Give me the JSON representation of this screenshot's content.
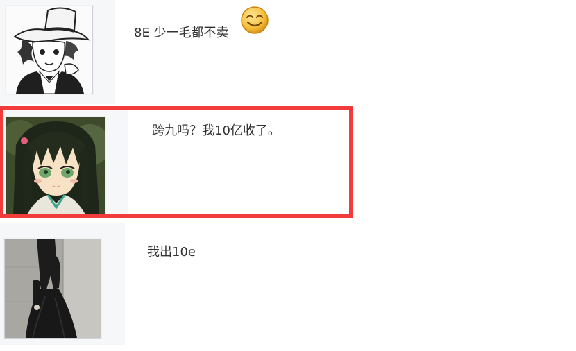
{
  "posts": [
    {
      "text": "8E 少一毛都不卖",
      "avatar": "manga-boy-avatar",
      "emoji": "smile-emoji"
    },
    {
      "text": "跨九吗？我10亿收了。",
      "avatar": "anime-girl-avatar"
    },
    {
      "text": "我出10e",
      "avatar": "dark-dress-avatar"
    }
  ],
  "colors": {
    "highlight": "#f23b3b",
    "text": "#333333",
    "avatar_column": "#f6f7f9"
  }
}
